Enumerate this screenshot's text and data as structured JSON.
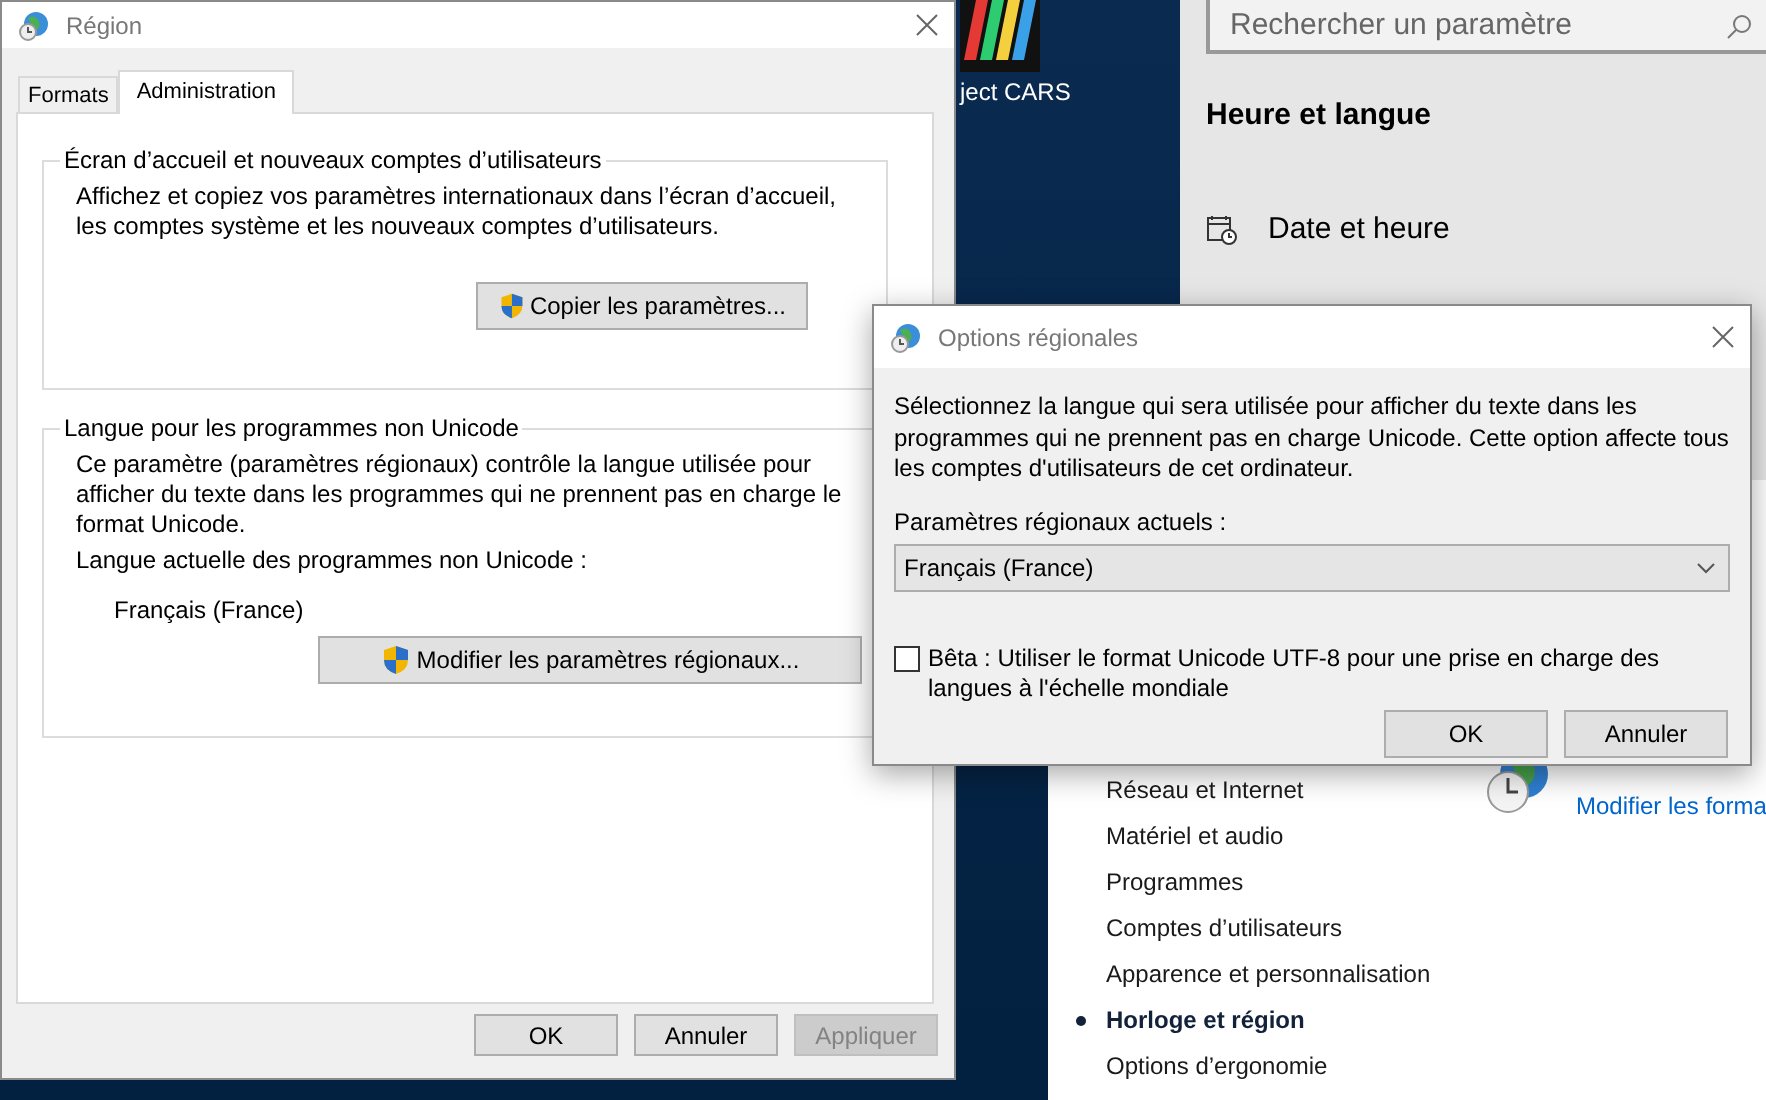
{
  "desktop": {
    "icons": [
      {
        "label": "ject CARS"
      }
    ]
  },
  "settings_window": {
    "search": {
      "placeholder": "Rechercher un paramètre"
    },
    "heading": "Heure et langue",
    "items": [
      {
        "label": "Date et heure"
      }
    ]
  },
  "control_panel": {
    "nav": [
      {
        "label": "Réseau et Internet",
        "selected": false
      },
      {
        "label": "Matériel et audio",
        "selected": false
      },
      {
        "label": "Programmes",
        "selected": false
      },
      {
        "label": "Comptes d’utilisateurs",
        "selected": false
      },
      {
        "label": "Apparence et personnalisation",
        "selected": false
      },
      {
        "label": "Horloge et région",
        "selected": true
      },
      {
        "label": "Options d’ergonomie",
        "selected": false
      }
    ],
    "region": {
      "link": "Modifier les forma"
    }
  },
  "region_window": {
    "title": "Région",
    "tabs": [
      {
        "label": "Formats",
        "selected": false
      },
      {
        "label": "Administration",
        "selected": true
      }
    ],
    "groups": [
      {
        "legend": "Écran d’accueil et nouveaux comptes d’utilisateurs",
        "text": "Affichez et copiez vos paramètres internationaux dans l’écran d’accueil, les comptes système et les nouveaux comptes d’utilisateurs.",
        "button": "Copier les paramètres..."
      },
      {
        "legend": "Langue pour les programmes non Unicode",
        "text": "Ce paramètre (paramètres régionaux) contrôle la langue utilisée pour afficher du texte dans les programmes qui ne prennent pas en charge le format Unicode.",
        "current_label": "Langue actuelle des programmes non Unicode :",
        "current_value": "Français (France)",
        "button": "Modifier les paramètres régionaux..."
      }
    ],
    "buttons": [
      {
        "label": "OK",
        "disabled": false
      },
      {
        "label": "Annuler",
        "disabled": false
      },
      {
        "label": "Appliquer",
        "disabled": true
      }
    ]
  },
  "options_dialog": {
    "title": "Options régionales",
    "description": "Sélectionnez la langue qui sera utilisée pour afficher du texte dans les programmes qui ne prennent pas en charge Unicode. Cette option affecte tous les comptes d'utilisateurs de cet ordinateur.",
    "locale_label": "Paramètres régionaux actuels :",
    "locale_value": "Français (France)",
    "beta": {
      "label": "Bêta : Utiliser le format Unicode UTF-8 pour une prise en charge des langues à l'échelle mondiale",
      "checked": false
    },
    "buttons": [
      {
        "label": "OK",
        "disabled": false
      },
      {
        "label": "Annuler",
        "disabled": false
      }
    ]
  }
}
